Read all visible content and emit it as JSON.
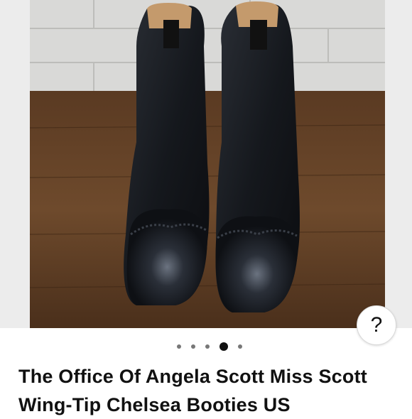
{
  "listing": {
    "title": "The Office Of Angela Scott Miss Scott Wing-Tip Chelsea Booties US"
  },
  "carousel": {
    "count": 5,
    "active_index": 3
  },
  "help_button": {
    "label": "?"
  },
  "icons": {
    "help": "question-mark-icon"
  }
}
